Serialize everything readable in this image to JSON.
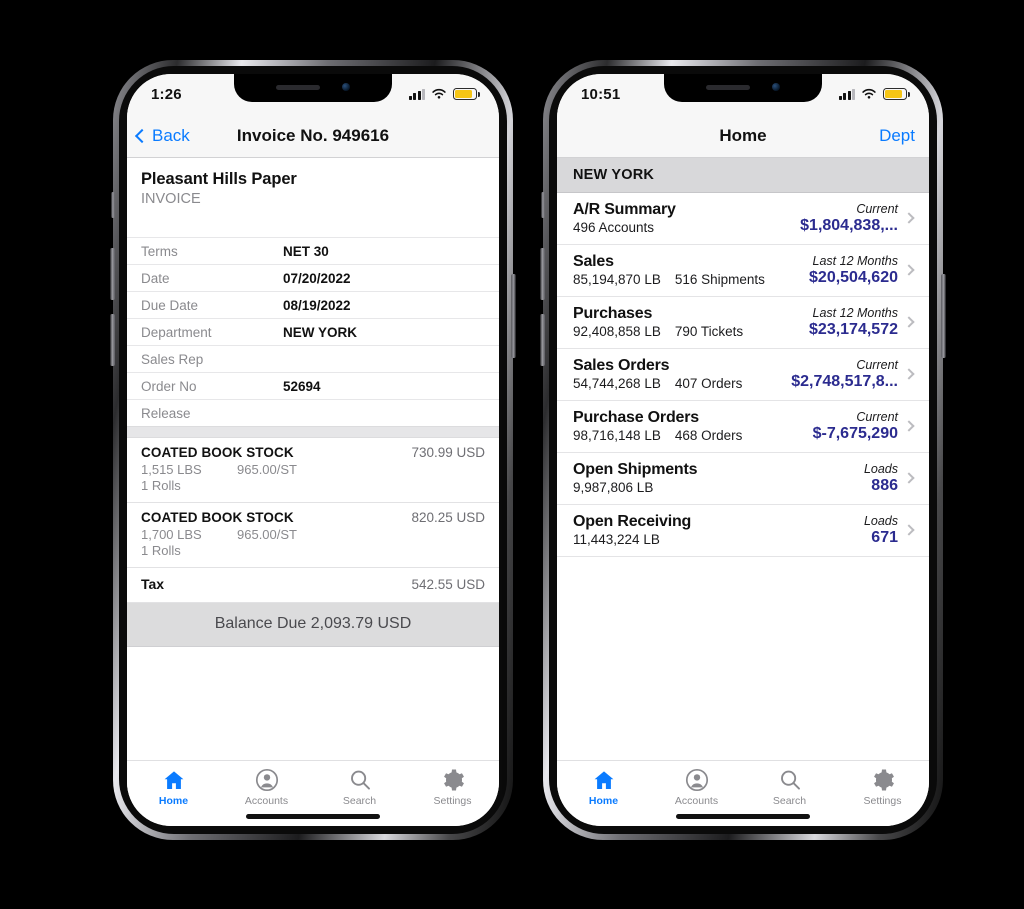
{
  "phones": [
    {
      "id": "invoice-phone",
      "statusbar": {
        "time": "1:26",
        "signal_icon": "cellular-bars-icon",
        "wifi_icon": "wifi-icon",
        "battery_icon": "battery-icon",
        "battery_color": "#f5c515"
      },
      "navbar": {
        "back_label": "Back",
        "back_icon": "chevron-left-icon",
        "title": "Invoice No. 949616",
        "accent": "#0a7bff"
      },
      "invoice": {
        "party": "Pleasant Hills Paper",
        "doc_type": "INVOICE",
        "fields": [
          {
            "label": "Terms",
            "value": "NET 30"
          },
          {
            "label": "Date",
            "value": "07/20/2022"
          },
          {
            "label": "Due Date",
            "value": "08/19/2022"
          },
          {
            "label": "Department",
            "value": "NEW YORK"
          },
          {
            "label": "Sales Rep",
            "value": ""
          },
          {
            "label": "Order No",
            "value": "52694"
          },
          {
            "label": "Release",
            "value": ""
          }
        ],
        "line_items": [
          {
            "description": "COATED BOOK STOCK",
            "amount": "730.99 USD",
            "weight": "1,515 LBS",
            "rate": "965.00/ST",
            "units": "1 Rolls"
          },
          {
            "description": "COATED BOOK STOCK",
            "amount": "820.25 USD",
            "weight": "1,700 LBS",
            "rate": "965.00/ST",
            "units": "1 Rolls"
          }
        ],
        "tax": {
          "label": "Tax",
          "amount": "542.55 USD"
        },
        "balance": "Balance Due 2,093.79 USD"
      }
    },
    {
      "id": "home-phone",
      "statusbar": {
        "time": "10:51",
        "signal_icon": "cellular-bars-icon",
        "wifi_icon": "wifi-icon",
        "battery_icon": "battery-icon",
        "battery_color": "#f5c515"
      },
      "navbar": {
        "title": "Home",
        "action_label": "Dept",
        "accent": "#0a7bff"
      },
      "home": {
        "section_title": "NEW YORK",
        "value_color": "#2b2b8f",
        "rows": [
          {
            "title": "A/R Summary",
            "metrics": [
              "496 Accounts"
            ],
            "period": "Current",
            "value": "$1,804,838,..."
          },
          {
            "title": "Sales",
            "metrics": [
              "85,194,870 LB",
              "516 Shipments"
            ],
            "period": "Last 12 Months",
            "value": "$20,504,620"
          },
          {
            "title": "Purchases",
            "metrics": [
              "92,408,858 LB",
              "790 Tickets"
            ],
            "period": "Last 12 Months",
            "value": "$23,174,572"
          },
          {
            "title": "Sales Orders",
            "metrics": [
              "54,744,268 LB",
              "407 Orders"
            ],
            "period": "Current",
            "value": "$2,748,517,8..."
          },
          {
            "title": "Purchase Orders",
            "metrics": [
              "98,716,148 LB",
              "468 Orders"
            ],
            "period": "Current",
            "value": "$-7,675,290"
          },
          {
            "title": "Open Shipments",
            "metrics": [
              "9,987,806 LB"
            ],
            "period": "Loads",
            "value": "886"
          },
          {
            "title": "Open Receiving",
            "metrics": [
              "11,443,224 LB"
            ],
            "period": "Loads",
            "value": "671"
          }
        ]
      }
    }
  ],
  "tabbar": {
    "active_color": "#0a7bff",
    "inactive_color": "#8a8a8e",
    "tabs": [
      {
        "label": "Home",
        "icon": "home-icon",
        "active": true
      },
      {
        "label": "Accounts",
        "icon": "account-circle-icon",
        "active": false
      },
      {
        "label": "Search",
        "icon": "search-icon",
        "active": false
      },
      {
        "label": "Settings",
        "icon": "gear-icon",
        "active": false
      }
    ]
  }
}
